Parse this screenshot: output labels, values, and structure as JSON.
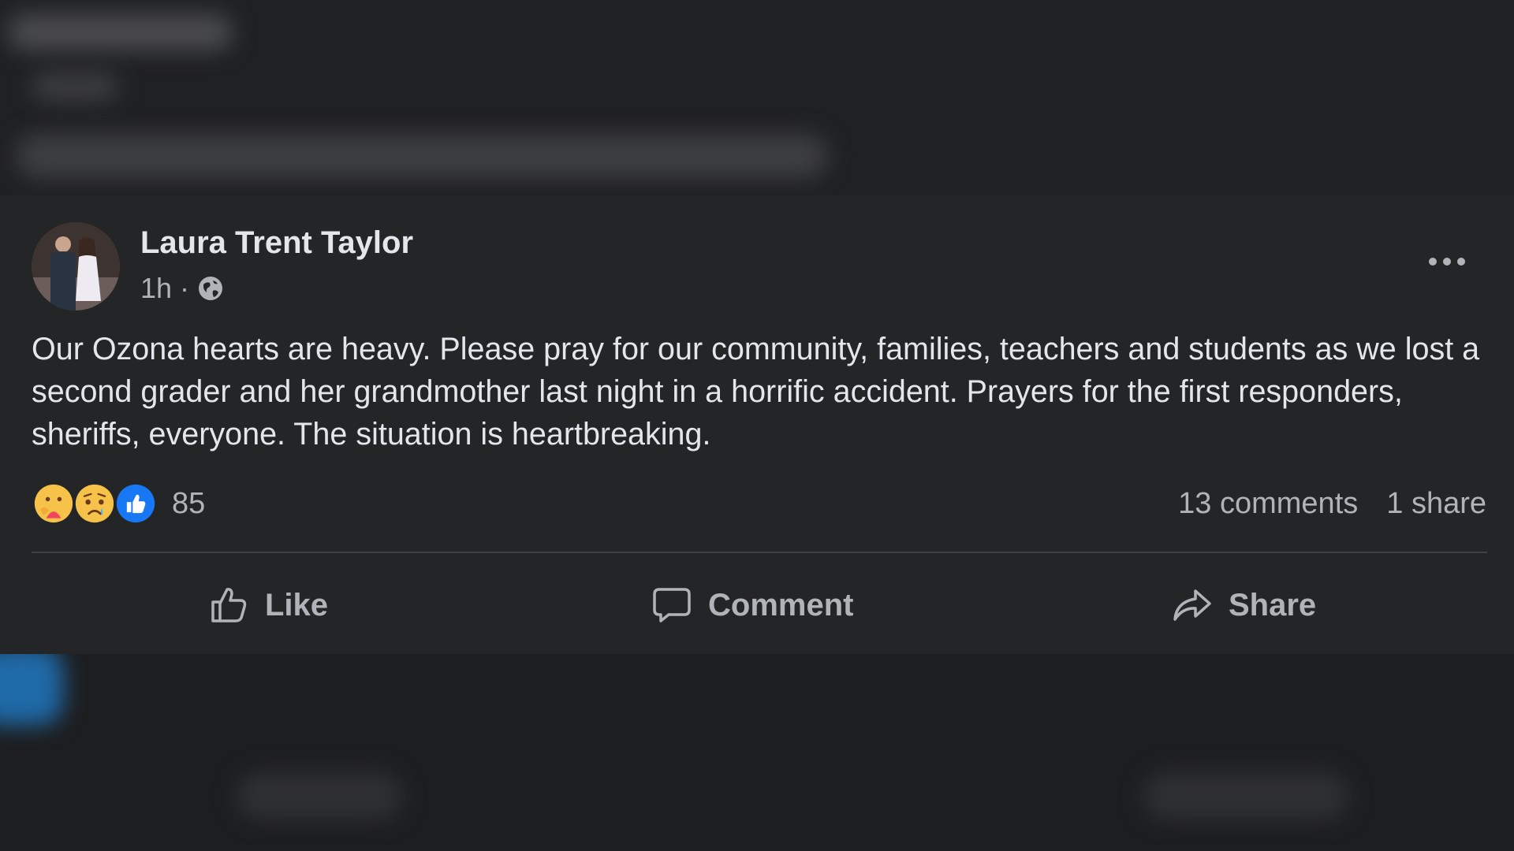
{
  "post": {
    "author": "Laura Trent Taylor",
    "time": "1h",
    "separator": "·",
    "audience_icon": "globe-icon",
    "more_icon": "more-options-icon",
    "text": "Our Ozona hearts are heavy. Please pray for our community, families, teachers and students as we lost a second grader and her grandmother last night in a horrific accident. Prayers for the first responders, sheriffs, everyone. The situation is heartbreaking.",
    "reactions": {
      "icons": [
        "care-reaction-icon",
        "sad-reaction-icon",
        "like-reaction-icon"
      ],
      "count": "85"
    },
    "comments": "13 comments",
    "shares": "1 share",
    "actions": {
      "like": "Like",
      "comment": "Comment",
      "share": "Share"
    }
  },
  "colors": {
    "background": "#1b1c1e",
    "card": "#242527",
    "primary_text": "#e4e6eb",
    "secondary_text": "#b0b3b8",
    "like_blue": "#1877f2"
  }
}
